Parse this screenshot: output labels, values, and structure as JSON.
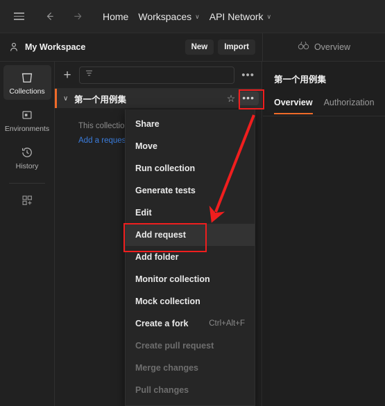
{
  "app": "Postman",
  "topbar": {
    "menu_icon": "hamburger-icon",
    "back_icon": "arrow-left-icon",
    "forward_icon": "arrow-right-icon",
    "home_label": "Home",
    "workspaces_label": "Workspaces",
    "workspaces_caret": "∨",
    "api_network_label": "API Network",
    "api_network_caret": "∨"
  },
  "workspace_bar": {
    "person_icon": "person-icon",
    "name": "My Workspace",
    "new_label": "New",
    "import_label": "Import"
  },
  "overview_bar": {
    "icon": "binoculars-icon",
    "label": "Overview"
  },
  "rail": {
    "items": [
      {
        "label": "Collections",
        "icon": "collections-icon",
        "active": true
      },
      {
        "label": "Environments",
        "icon": "environments-icon",
        "active": false
      },
      {
        "label": "History",
        "icon": "history-icon",
        "active": false
      }
    ],
    "add_apps_icon": "add-apps-icon"
  },
  "panel": {
    "plus_label": "+",
    "filter_icon": "filter-icon",
    "search_placeholder": "",
    "search_value": "",
    "more_label": "•••",
    "collection": {
      "chevron": "∨",
      "name": "第一个用例集",
      "star_icon": "star-icon",
      "dots_label": "•••"
    },
    "empty_text": "This collection is empty",
    "empty_link": "Add a request"
  },
  "context_menu": {
    "items": [
      {
        "label": "Share",
        "shortcut": "",
        "disabled": false,
        "hover": false
      },
      {
        "label": "Move",
        "shortcut": "",
        "disabled": false,
        "hover": false
      },
      {
        "label": "Run collection",
        "shortcut": "",
        "disabled": false,
        "hover": false
      },
      {
        "label": "Generate tests",
        "shortcut": "",
        "disabled": false,
        "hover": false
      },
      {
        "label": "Edit",
        "shortcut": "",
        "disabled": false,
        "hover": false
      },
      {
        "label": "Add request",
        "shortcut": "",
        "disabled": false,
        "hover": true
      },
      {
        "label": "Add folder",
        "shortcut": "",
        "disabled": false,
        "hover": false
      },
      {
        "label": "Monitor collection",
        "shortcut": "",
        "disabled": false,
        "hover": false
      },
      {
        "label": "Mock collection",
        "shortcut": "",
        "disabled": false,
        "hover": false
      },
      {
        "label": "Create a fork",
        "shortcut": "Ctrl+Alt+F",
        "disabled": false,
        "hover": false
      },
      {
        "label": "Create pull request",
        "shortcut": "",
        "disabled": true,
        "hover": false
      },
      {
        "label": "Merge changes",
        "shortcut": "",
        "disabled": true,
        "hover": false
      },
      {
        "label": "Pull changes",
        "shortcut": "",
        "disabled": true,
        "hover": false
      }
    ]
  },
  "content": {
    "title": "第一个用例集",
    "tabs": [
      {
        "label": "Overview",
        "active": true
      },
      {
        "label": "Authorization",
        "active": false
      }
    ]
  },
  "annotations": {
    "highlight_color": "#f01e1e",
    "boxes": [
      "collection-more-button",
      "add-request-menu-item"
    ],
    "arrow": "points from collection more button to Add request menu item"
  },
  "colors": {
    "accent": "#f06b29",
    "link": "#3b7ddd",
    "background": "#1e1e1e",
    "panel": "#212121"
  }
}
